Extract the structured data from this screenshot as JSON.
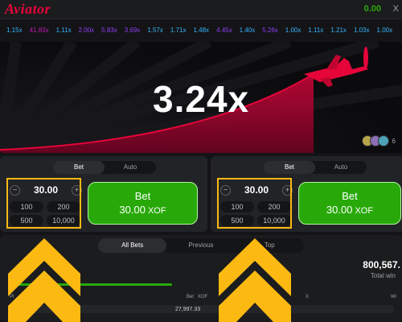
{
  "app": {
    "logo": "Aviator",
    "balance": "0.00",
    "balance_currency": "X"
  },
  "history": [
    {
      "v": "1.15x",
      "c": "blue"
    },
    {
      "v": "41.83x",
      "c": "pink"
    },
    {
      "v": "1.11x",
      "c": "blue"
    },
    {
      "v": "2.00x",
      "c": "purple"
    },
    {
      "v": "5.83x",
      "c": "purple"
    },
    {
      "v": "3.69x",
      "c": "purple"
    },
    {
      "v": "1.57x",
      "c": "blue"
    },
    {
      "v": "1.71x",
      "c": "blue"
    },
    {
      "v": "1.48x",
      "c": "blue"
    },
    {
      "v": "4.45x",
      "c": "purple"
    },
    {
      "v": "1.40x",
      "c": "blue"
    },
    {
      "v": "5.26x",
      "c": "purple"
    },
    {
      "v": "1.00x",
      "c": "blue"
    },
    {
      "v": "1.11x",
      "c": "blue"
    },
    {
      "v": "1.21x",
      "c": "blue"
    },
    {
      "v": "1.03x",
      "c": "blue"
    },
    {
      "v": "1.00x",
      "c": "blue"
    }
  ],
  "game": {
    "multiplier": "3.24x",
    "players_count": "6"
  },
  "panels": [
    {
      "tabs": [
        "Bet",
        "Auto"
      ],
      "active_tab": "Bet",
      "amount": "30.00",
      "quick": [
        "100",
        "200",
        "500",
        "10,000"
      ],
      "bet_label": "Bet",
      "bet_amount": "30.00",
      "bet_currency": "XOF"
    },
    {
      "tabs": [
        "Bet",
        "Auto"
      ],
      "active_tab": "Bet",
      "amount": "30.00",
      "quick": [
        "100",
        "200",
        "500",
        "10,000"
      ],
      "bet_label": "Bet",
      "bet_amount": "30.00",
      "bet_currency": "XOF"
    }
  ],
  "bets": {
    "tabs": [
      "All Bets",
      "Previous",
      "Top"
    ],
    "active_tab": "All Bets",
    "total_win": "800,567.",
    "total_win_label": "Total win",
    "columns": {
      "player": "Pl",
      "bet": "Bet",
      "currency": "XOF",
      "x": "X",
      "win": "Wi"
    },
    "row_bet": "27,997.33"
  },
  "colors": {
    "accent_red": "#e50539",
    "green": "#28a909",
    "history_blue": "#34b4ff",
    "history_purple": "#913ef8",
    "history_pink": "#c017b4",
    "stripe_yellow": "#fcb912"
  }
}
